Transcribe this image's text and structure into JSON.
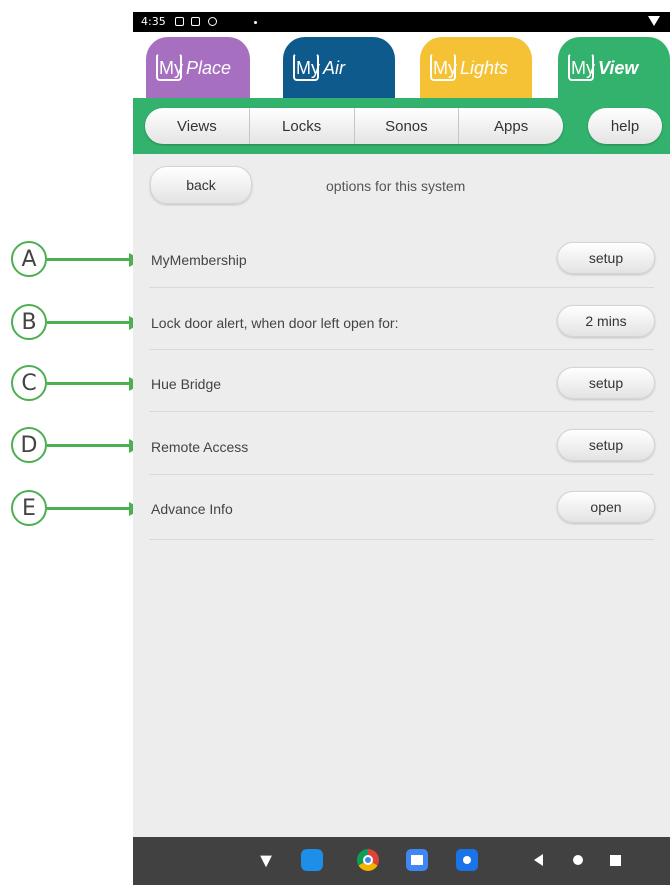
{
  "status_bar": {
    "time": "4:35"
  },
  "app_tabs": [
    {
      "my": "My",
      "name": "Place",
      "color": "#a76fbf"
    },
    {
      "my": "My",
      "name": "Air",
      "color": "#0f5a8c"
    },
    {
      "my": "My",
      "name": "Lights",
      "color": "#f6c235"
    },
    {
      "my": "My",
      "name": "View",
      "color": "#33b26d"
    }
  ],
  "nav": {
    "items": [
      {
        "label": "Views"
      },
      {
        "label": "Locks"
      },
      {
        "label": "Sonos"
      },
      {
        "label": "Apps"
      }
    ],
    "help_label": "help"
  },
  "page": {
    "back_label": "back",
    "title": "options for this system"
  },
  "rows": [
    {
      "callout": "A",
      "label": "MyMembership",
      "button": "setup"
    },
    {
      "callout": "B",
      "label": "Lock door alert, when door left open for:",
      "button": "2 mins"
    },
    {
      "callout": "C",
      "label": "Hue Bridge",
      "button": "setup"
    },
    {
      "callout": "D",
      "label": "Remote Access",
      "button": "setup"
    },
    {
      "callout": "E",
      "label": "Advance Info",
      "button": "open"
    }
  ],
  "taskbar": {
    "icons": [
      "wifi-icon",
      "teamviewer-icon",
      "chrome-icon",
      "calendar-icon",
      "camera-icon"
    ],
    "nav_icons": [
      "back-icon",
      "home-icon",
      "recents-icon"
    ]
  },
  "colors": {
    "accent_green": "#33b26d",
    "callout_green": "#4caf50",
    "screen_background": "#ededed"
  }
}
